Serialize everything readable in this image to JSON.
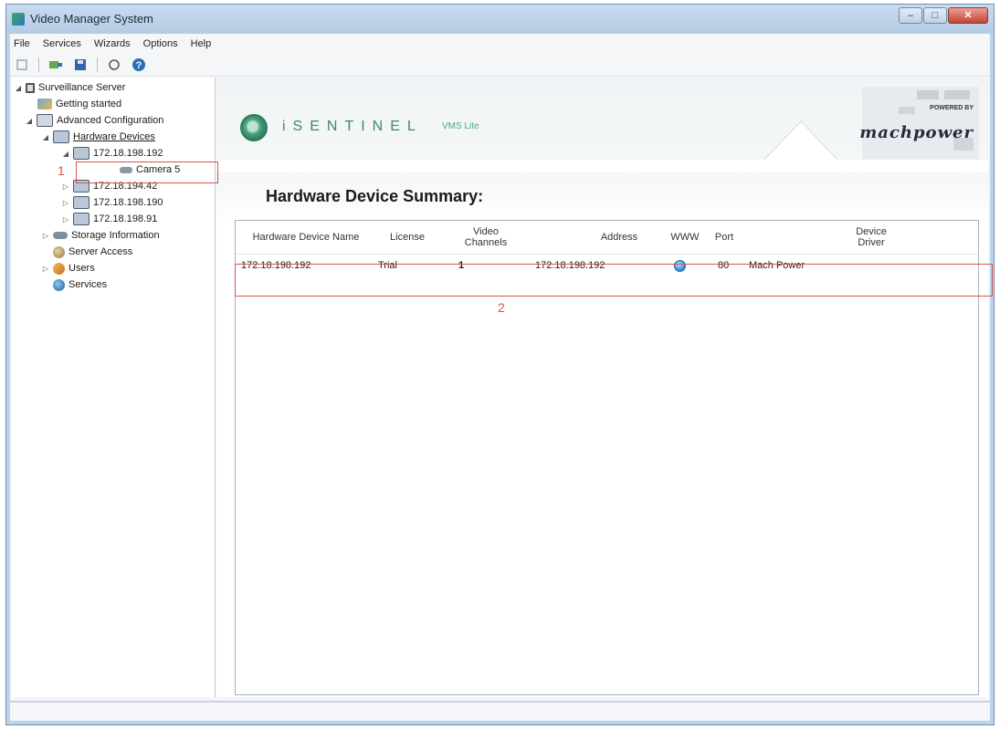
{
  "window": {
    "title": "Video Manager System",
    "buttons": {
      "minimize": "–",
      "maximize": "□",
      "close": "✕"
    }
  },
  "menu": [
    "File",
    "Services",
    "Wizards",
    "Options",
    "Help"
  ],
  "toolbar": {
    "icons": [
      "add-icon",
      "sep",
      "camera-add-icon",
      "save-icon",
      "sep",
      "refresh-icon",
      "help-icon"
    ]
  },
  "tree": {
    "root": "Surveillance Server",
    "getting_started": "Getting started",
    "advanced_config": "Advanced Configuration",
    "hardware_devices": "Hardware Devices",
    "device_selected": "172.18.198.192",
    "camera": "Camera 5",
    "device2": "172.18.194.42",
    "device3": "172.18.198.190",
    "device4": "172.18.198.91",
    "storage": "Storage Information",
    "server_access": "Server Access",
    "users": "Users",
    "services": "Services"
  },
  "banner": {
    "brand": "iSENTINEL",
    "edition": "VMS Lite",
    "powered_by": "POWERED BY",
    "partner": "machpower"
  },
  "summary": {
    "title": "Hardware Device Summary:",
    "columns": {
      "name": "Hardware Device Name",
      "license": "License",
      "channels": "Video Channels",
      "address": "Address",
      "www": "WWW",
      "port": "Port",
      "driver": "Device Driver"
    },
    "rows": [
      {
        "name": "172.18.198.192",
        "license": "Trial",
        "channels": "1",
        "address": "172.18.198.192",
        "www": "globe-icon",
        "port": "80",
        "driver": "Mach Power"
      }
    ]
  },
  "annotations": {
    "first": "1",
    "second": "2"
  },
  "colors": {
    "annotation": "#d9534f",
    "brand": "#3a8a6b"
  }
}
